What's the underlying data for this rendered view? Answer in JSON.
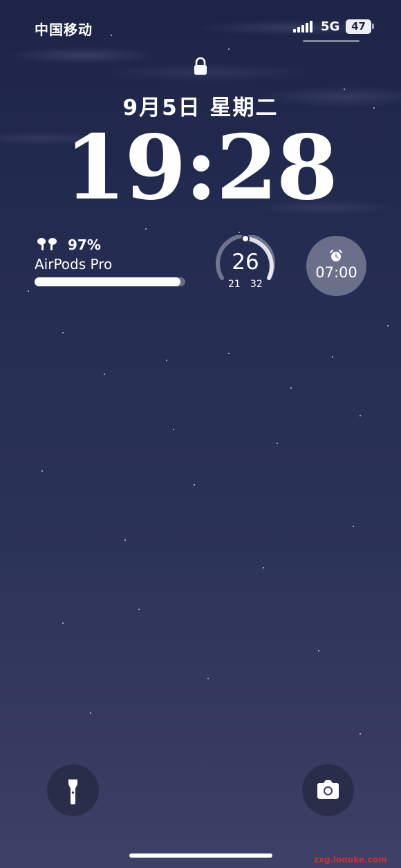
{
  "status_bar": {
    "carrier": "中国移动",
    "network": "5G",
    "battery": "47",
    "signal_bars": 5
  },
  "lock_screen": {
    "date": "9月5日 星期二",
    "time": "19:28"
  },
  "widgets": {
    "airpods": {
      "percent": "97%",
      "name": "AirPods Pro",
      "level": 0.97
    },
    "weather": {
      "temp": "26",
      "low": "21",
      "high": "32"
    },
    "alarm": {
      "time": "07:00",
      "icon": "alarm-clock-icon"
    }
  },
  "controls": {
    "left_icon": "flashlight-icon",
    "right_icon": "camera-icon"
  },
  "watermark": "zxg.ionuke.com",
  "colors": {
    "background_top": "#1d2447",
    "background_bottom": "#3e4166",
    "text": "#ffffff"
  }
}
